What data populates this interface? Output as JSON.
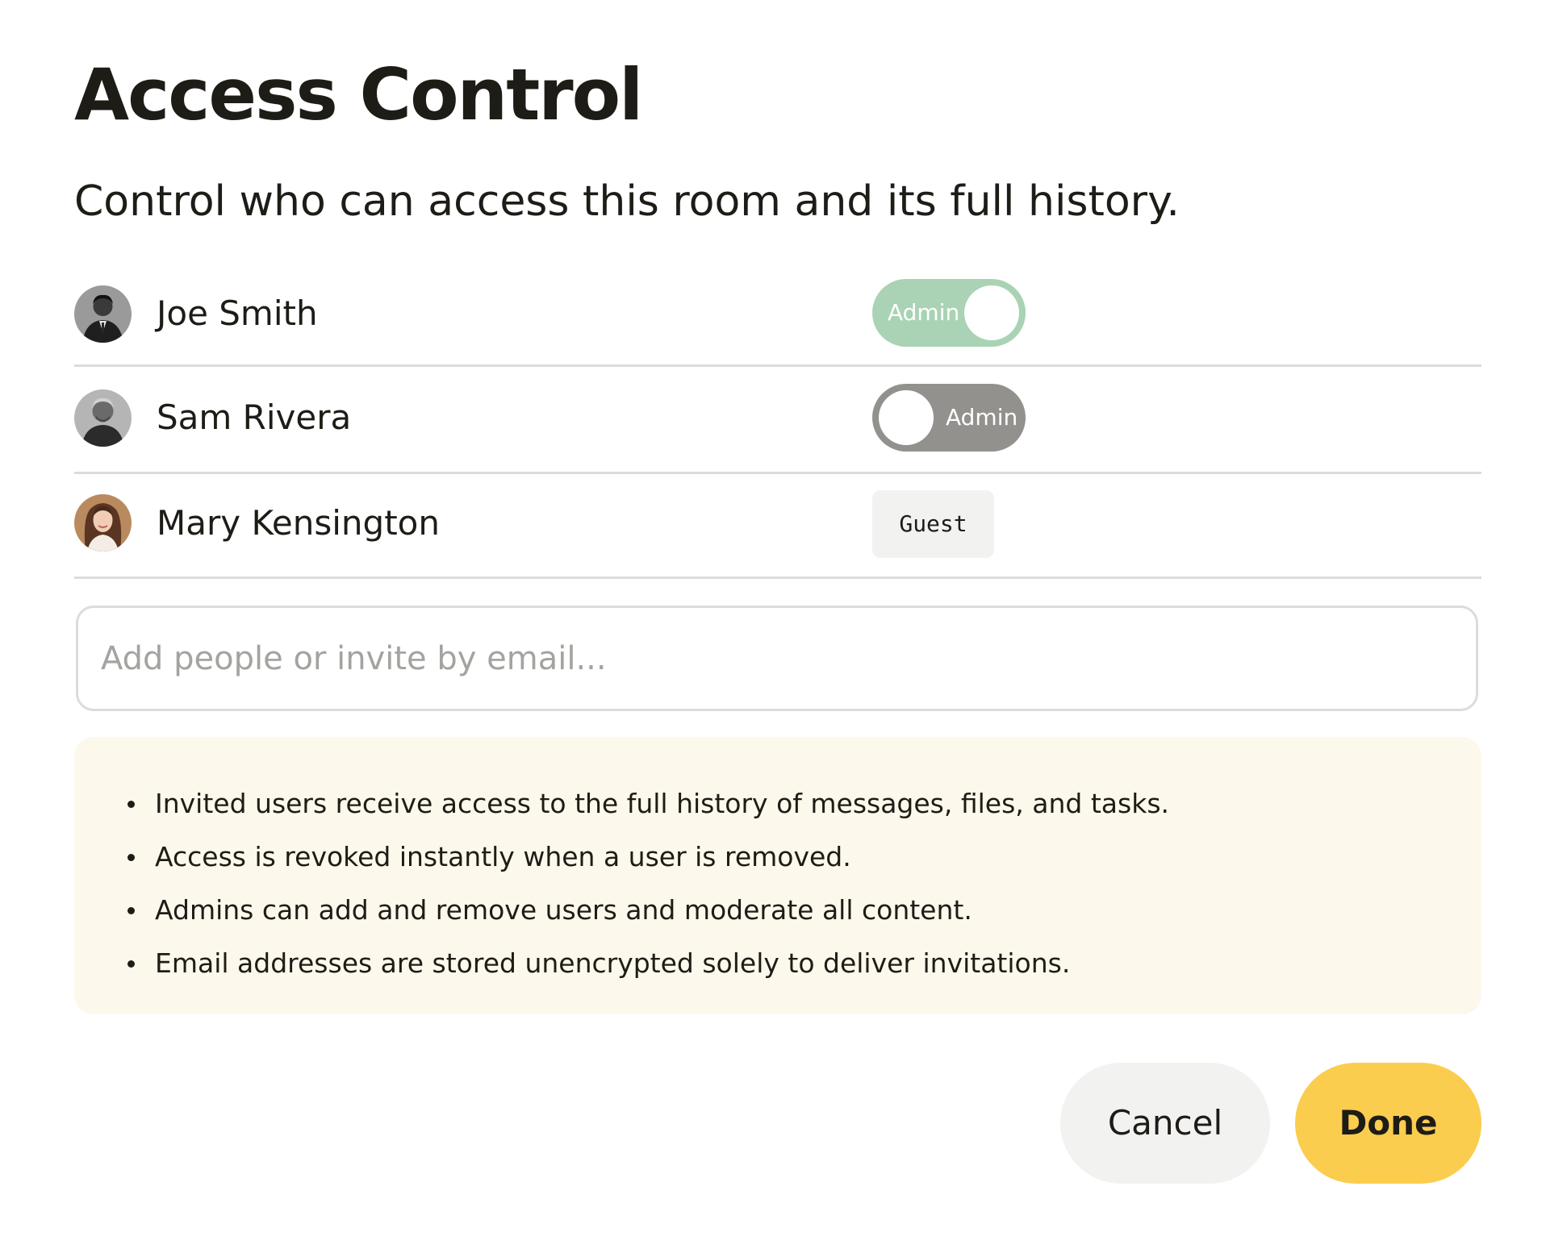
{
  "dialog": {
    "title": "Access Control",
    "subtitle": "Control who can access this room and its full history."
  },
  "members": [
    {
      "name": "Joe Smith",
      "role_control": "toggle",
      "role_label": "Admin",
      "admin_enabled": true,
      "avatar_icon": "user-avatar-photo"
    },
    {
      "name": "Sam Rivera",
      "role_control": "toggle",
      "role_label": "Admin",
      "admin_enabled": false,
      "avatar_icon": "user-avatar-photo"
    },
    {
      "name": "Mary Kensington",
      "role_control": "badge",
      "role_label": "Guest",
      "avatar_icon": "user-avatar-photo"
    }
  ],
  "invite": {
    "placeholder": "Add people or invite by email...",
    "value": ""
  },
  "notice": {
    "items": [
      "Invited users receive access to the full history of messages, files, and tasks.",
      "Access is revoked instantly when a user is removed.",
      "Admins can add and remove users and moderate all content.",
      "Email addresses are stored unencrypted solely to deliver invitations."
    ]
  },
  "actions": {
    "cancel_label": "Cancel",
    "done_label": "Done"
  },
  "colors": {
    "text": "#1e1c16",
    "toggle_on": "#a9d3b4",
    "toggle_off": "#93918d",
    "notice_background": "#fdf8ec",
    "primary_button": "#fbcd4e",
    "secondary_button": "#f2f2f1",
    "divider": "#dcdcdc"
  }
}
